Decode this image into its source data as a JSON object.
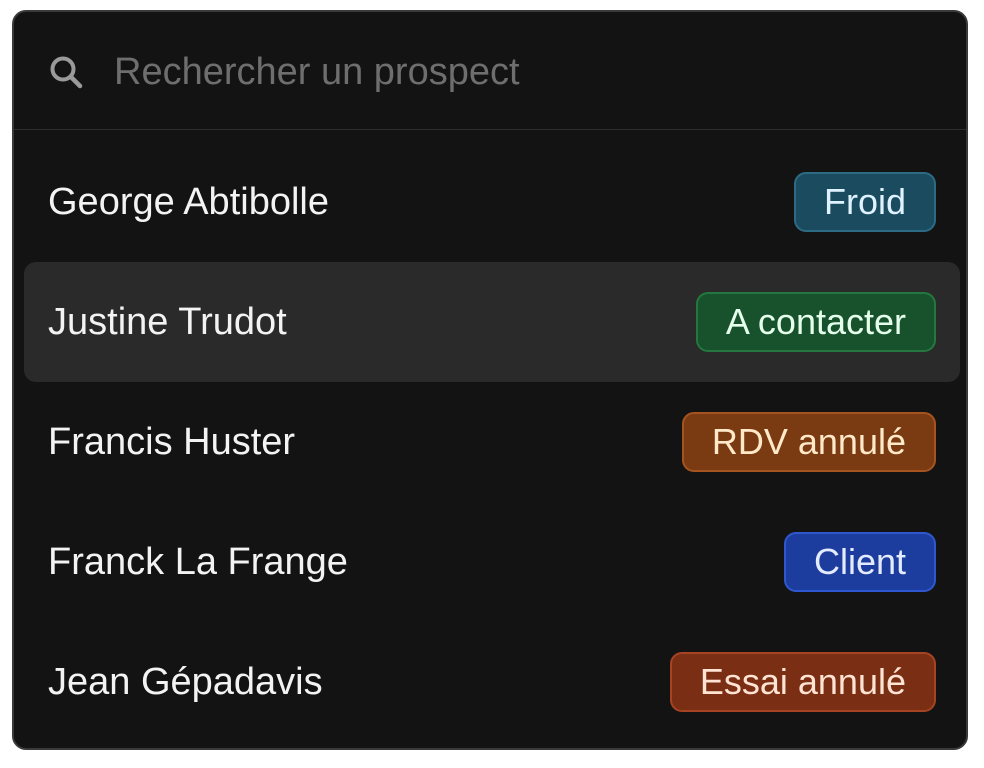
{
  "search": {
    "placeholder": "Rechercher un prospect",
    "icon": "search-icon"
  },
  "prospects": [
    {
      "name": "George Abtibolle",
      "status": "Froid",
      "status_bg": "#1b4b5f",
      "status_border": "#2d6a84",
      "status_color": "#dff2ff"
    },
    {
      "name": "Justine Trudot",
      "status": "A contacter",
      "status_bg": "#17522d",
      "status_border": "#25773f",
      "status_color": "#e6ffec",
      "highlighted": true
    },
    {
      "name": "Francis Huster",
      "status": "RDV annulé",
      "status_bg": "#7a3a12",
      "status_border": "#a55420",
      "status_color": "#ffe9c8"
    },
    {
      "name": "Franck La Frange",
      "status": "Client",
      "status_bg": "#1d3d9e",
      "status_border": "#2f57cf",
      "status_color": "#e3ebff"
    },
    {
      "name": "Jean Gépadavis",
      "status": "Essai annulé",
      "status_bg": "#7a2e14",
      "status_border": "#a64322",
      "status_color": "#ffe3d3"
    }
  ],
  "colors": {
    "panel_bg": "#131313",
    "highlight_bg": "#2a2a2a",
    "text": "#f3f3f3",
    "placeholder": "#6e6e6e"
  }
}
